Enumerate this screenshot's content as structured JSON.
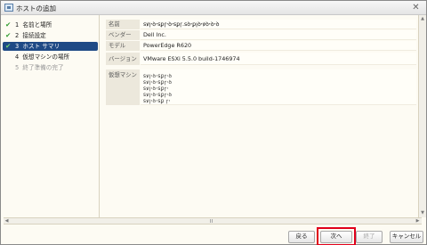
{
  "window": {
    "title": "ホストの追加",
    "close_glyph": "✕",
    "icon": "host-add-icon"
  },
  "steps": [
    {
      "number": "1",
      "label": "名前と場所",
      "completed": true
    },
    {
      "number": "2",
      "label": "接続設定",
      "completed": true
    },
    {
      "number": "3",
      "label": "ホスト サマリ",
      "completed": true,
      "active": true
    },
    {
      "number": "4",
      "label": "仮想マシンの場所",
      "completed": false
    },
    {
      "number": "5",
      "label": "終了準備の完了",
      "completed": false
    }
  ],
  "check_glyph": "✔",
  "summary": {
    "name_label": "名前",
    "name_value": "ꜱꝟꞁꞏꝺꞏꜱꝑꞅꞏꝺꞏꜱꝑꞅ.ꜱꝺꞏꝑꞁꝺꞏꝟꝺꞏꝺꞏꝺ",
    "vendor_label": "ベンダー",
    "vendor_value": "Dell Inc.",
    "model_label": "モデル",
    "model_value": "PowerEdge R620",
    "version_label": "バージョン",
    "version_value": "VMware ESXi 5.5.0 build-1746974",
    "vms_label": "仮想マシン",
    "vms": [
      "ꜱꝟꞁꞏꝺꞏꜱꝑꞅꞏꝺ",
      "ꜱꝟꞁꞏꝺꞏꜱꝑꞅꞏꝺ",
      "ꜱꝟꞁꞏꝺꞏꜱꝑꞅꞏ",
      "ꜱꝟꞁꞏꝺꞏꜱꝑꞅꞏꝺ",
      "ꜱꝟꞁꞏꝺꞏꜱꝑ ꞅꞏ"
    ]
  },
  "scrollbar": {
    "up_glyph": "▲",
    "down_glyph": "▼",
    "left_glyph": "◀",
    "right_glyph": "▶"
  },
  "buttons": {
    "back": "戻る",
    "next": "次へ",
    "finish": "終了",
    "cancel": "キャンセル"
  },
  "colors": {
    "active_step_bg": "#1f4a85",
    "check": "#2e9b2e",
    "highlight": "#e0001b"
  }
}
